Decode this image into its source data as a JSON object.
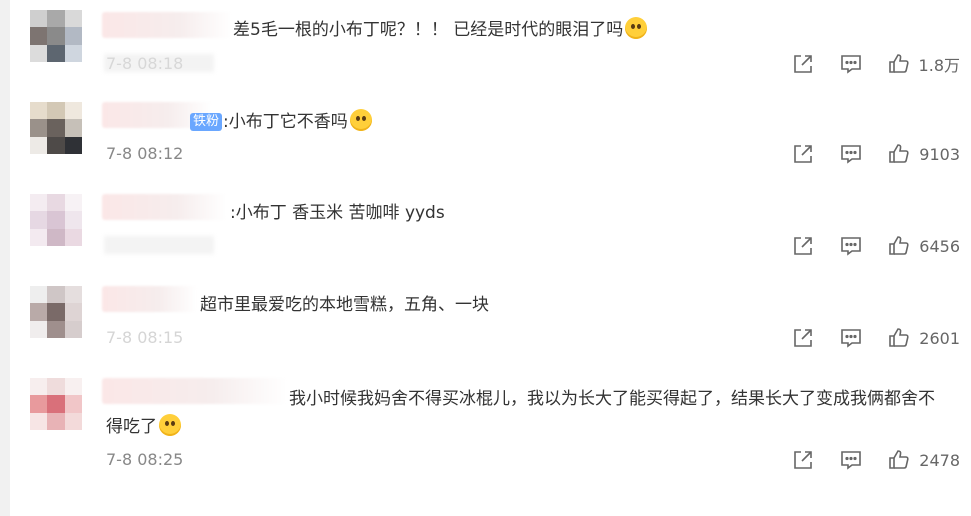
{
  "comments": [
    {
      "text": "差5毛一根的小布丁呢？！！ 已经是时代的眼泪了吗",
      "time": "7-8 08:18",
      "likes": "1.8万"
    },
    {
      "fan_badge": "铁粉",
      "text": ":小布丁它不香吗",
      "time": "7-8 08:12",
      "likes": "9103"
    },
    {
      "text": ":小布丁 香玉米 苦咖啡 yyds",
      "time": "",
      "likes": "6456"
    },
    {
      "text": "超市里最爱吃的本地雪糕，五角、一块",
      "time": "7-8 08:15",
      "likes": "2601"
    },
    {
      "text": "我小时候我妈舍不得买冰棍儿，我以为长大了能买得起了，结果长大了变成我俩都舍不得吃了",
      "time": "7-8 08:25",
      "likes": "2478"
    }
  ],
  "icons": [
    "share-icon",
    "comment-icon",
    "like-icon",
    "emoji-icon"
  ],
  "colors": {
    "text": "#333333",
    "meta": "#888888",
    "badge": "#6aa7ff",
    "emoji": "#ffcf3a"
  }
}
